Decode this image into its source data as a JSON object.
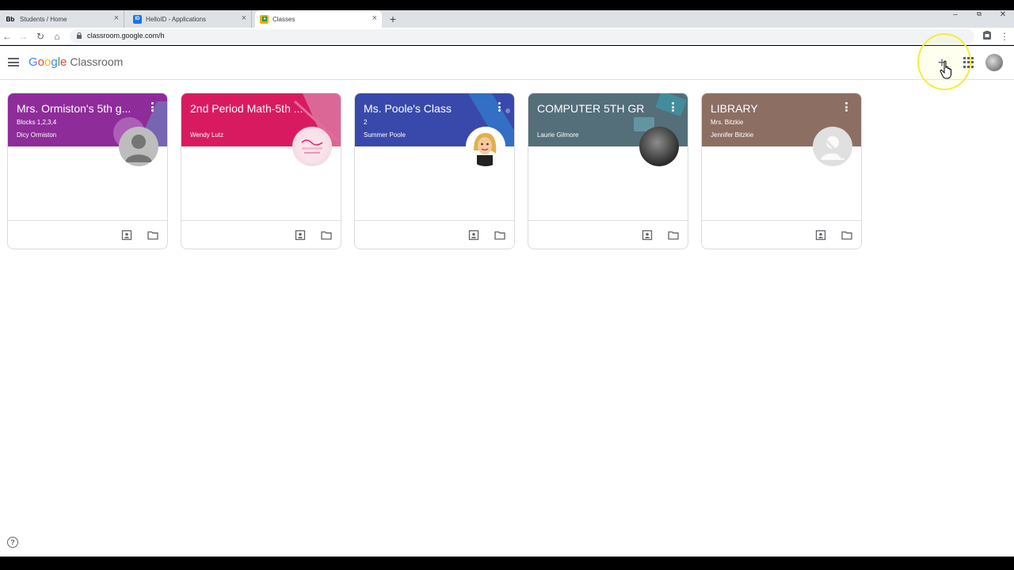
{
  "browser": {
    "tabs": [
      {
        "title": "Students / Home",
        "favicon": "Bb",
        "favicon_color": "#000000",
        "favicon_bg": "#dee1e6"
      },
      {
        "title": "HelloID - Applications",
        "favicon": "ID",
        "favicon_color": "#ffffff",
        "favicon_bg": "#1a73e8"
      },
      {
        "title": "Classes",
        "favicon": "",
        "favicon_color": "#ffffff",
        "favicon_bg": "#f9ab00"
      }
    ],
    "new_tab_glyph": "+",
    "url": "classroom.google.com/h",
    "nav": {
      "back": "←",
      "forward": "→",
      "reload": "↻",
      "home": "⌂"
    },
    "window_controls": {
      "minimize": "–",
      "maximize": "⧉",
      "close": "✕"
    },
    "menu_glyph": "⋮"
  },
  "app": {
    "logo_letters": [
      {
        "ch": "G",
        "color": "#4285f4"
      },
      {
        "ch": "o",
        "color": "#ea4335"
      },
      {
        "ch": "o",
        "color": "#fbbc05"
      },
      {
        "ch": "g",
        "color": "#4285f4"
      },
      {
        "ch": "l",
        "color": "#34a853"
      },
      {
        "ch": "e",
        "color": "#ea4335"
      }
    ],
    "product_name": "Classroom",
    "plus_glyph": "+"
  },
  "classes": [
    {
      "title": "Mrs. Ormiston's 5th g...",
      "section": "Blocks 1,2,3,4",
      "teacher": "Dicy Ormiston",
      "color": "#8e2c9a",
      "avatar": "default-person",
      "deco_color": "#4dd0e1"
    },
    {
      "title": "2nd Period Math-5th ...",
      "section": "",
      "teacher": "Wendy Lutz",
      "color": "#d81b60",
      "avatar": "photo-pink",
      "deco_color": "#b3e5fc"
    },
    {
      "title": "Ms. Poole's Class",
      "section": "2",
      "teacher": "Summer Poole",
      "color": "#3949ab",
      "avatar": "bitmoji",
      "deco_color": "#29b6f6"
    },
    {
      "title": "COMPUTER 5TH GR",
      "section": "",
      "teacher": "Laurie Gilmore",
      "color": "#546e7a",
      "avatar": "photo-dark",
      "deco_color": "#26c6da"
    },
    {
      "title": "LIBRARY",
      "section": "Mrs. Bitzkie",
      "teacher": "Jennifer Bitzkie",
      "color": "#8d6e63",
      "avatar": "no-photo",
      "deco_color": "#8d6e63"
    }
  ],
  "help_glyph": "?"
}
